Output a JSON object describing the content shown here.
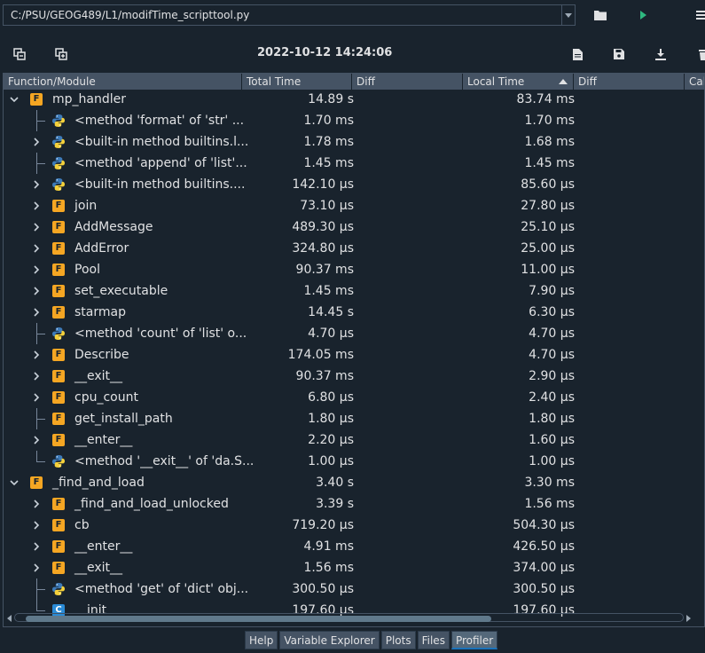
{
  "path": "C:/PSU/GEOG489/L1/modifTime_scripttool.py",
  "datetime": "2022-10-12 14:24:06",
  "headers": [
    "Function/Module",
    "Total Time",
    "Diff",
    "Local Time",
    "Diff",
    "Cal"
  ],
  "rows": [
    {
      "name": "mp_handler",
      "total": "14.89 s",
      "local": "83.74 ms",
      "icon": "function-icon"
    },
    {
      "name": "<method 'format' of 'str' ...",
      "total": "1.70 ms",
      "local": "1.70 ms",
      "icon": "python-icon"
    },
    {
      "name": "<built-in method builtins.l...",
      "total": "1.78 ms",
      "local": "1.68 ms",
      "icon": "python-icon"
    },
    {
      "name": "<method 'append' of 'list'...",
      "total": "1.45 ms",
      "local": "1.45 ms",
      "icon": "python-icon"
    },
    {
      "name": "<built-in method builtins....",
      "total": "142.10 µs",
      "local": "85.60 µs",
      "icon": "python-icon"
    },
    {
      "name": "join",
      "total": "73.10 µs",
      "local": "27.80 µs",
      "icon": "function-icon"
    },
    {
      "name": "AddMessage",
      "total": "489.30 µs",
      "local": "25.10 µs",
      "icon": "function-icon"
    },
    {
      "name": "AddError",
      "total": "324.80 µs",
      "local": "25.00 µs",
      "icon": "function-icon"
    },
    {
      "name": "Pool",
      "total": "90.37 ms",
      "local": "11.00 µs",
      "icon": "function-icon"
    },
    {
      "name": "set_executable",
      "total": "1.45 ms",
      "local": "7.90 µs",
      "icon": "function-icon"
    },
    {
      "name": "starmap",
      "total": "14.45 s",
      "local": "6.30 µs",
      "icon": "function-icon"
    },
    {
      "name": "<method 'count' of 'list' o...",
      "total": "4.70 µs",
      "local": "4.70 µs",
      "icon": "python-icon"
    },
    {
      "name": "Describe",
      "total": "174.05 ms",
      "local": "4.70 µs",
      "icon": "function-icon"
    },
    {
      "name": "__exit__",
      "total": "90.37 ms",
      "local": "2.90 µs",
      "icon": "function-icon"
    },
    {
      "name": "cpu_count",
      "total": "6.80 µs",
      "local": "2.40 µs",
      "icon": "function-icon"
    },
    {
      "name": "get_install_path",
      "total": "1.80 µs",
      "local": "1.80 µs",
      "icon": "function-icon"
    },
    {
      "name": "__enter__",
      "total": "2.20 µs",
      "local": "1.60 µs",
      "icon": "function-icon"
    },
    {
      "name": "<method '__exit__' of 'da.S...",
      "total": "1.00 µs",
      "local": "1.00 µs",
      "icon": "python-icon"
    },
    {
      "name": "_find_and_load",
      "total": "3.40 s",
      "local": "3.30 ms",
      "icon": "function-icon"
    },
    {
      "name": "_find_and_load_unlocked",
      "total": "3.39 s",
      "local": "1.56 ms",
      "icon": "function-icon"
    },
    {
      "name": "cb",
      "total": "719.20 µs",
      "local": "504.30 µs",
      "icon": "function-icon"
    },
    {
      "name": "__enter__",
      "total": "4.91 ms",
      "local": "426.50 µs",
      "icon": "function-icon"
    },
    {
      "name": "__exit__",
      "total": "1.56 ms",
      "local": "374.00 µs",
      "icon": "function-icon"
    },
    {
      "name": "<method 'get' of 'dict' obj...",
      "total": "300.50 µs",
      "local": "300.50 µs",
      "icon": "python-icon"
    },
    {
      "name": "__init__",
      "total": "197.60 µs",
      "local": "197.60 µs",
      "icon": "class-icon"
    }
  ],
  "icon_letters": {
    "function": "F",
    "class": "C"
  },
  "tabs": [
    "Help",
    "Variable Explorer",
    "Plots",
    "Files",
    "Profiler"
  ],
  "active_tab": "Profiler",
  "colors": {
    "background": "#19232d",
    "header": "#455364",
    "function_icon": "#f5a623",
    "class_icon": "#2a8bd6",
    "accent": "#1a72bb"
  }
}
